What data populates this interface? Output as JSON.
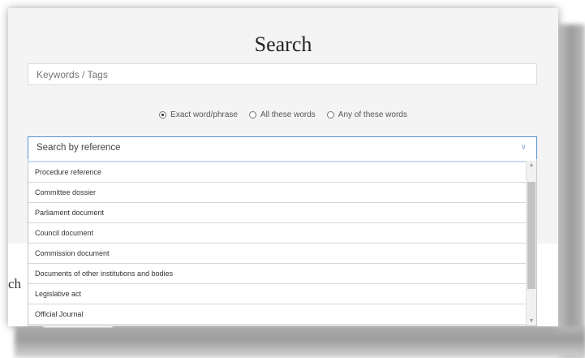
{
  "search": {
    "title": "Search",
    "keywords_placeholder": "Keywords / Tags"
  },
  "match_mode": {
    "options": [
      "Exact word/phrase",
      "All these words",
      "Any of these words"
    ],
    "selected": "Exact word/phrase"
  },
  "reference": {
    "label": "Search by reference",
    "options": [
      "Procedure reference",
      "Committee dossier",
      "Parliament document",
      "Council document",
      "Commission document",
      "Documents of other institutions and bodies",
      "Legislative act",
      "Official Journal"
    ]
  },
  "background": {
    "partial_text": "ch"
  }
}
